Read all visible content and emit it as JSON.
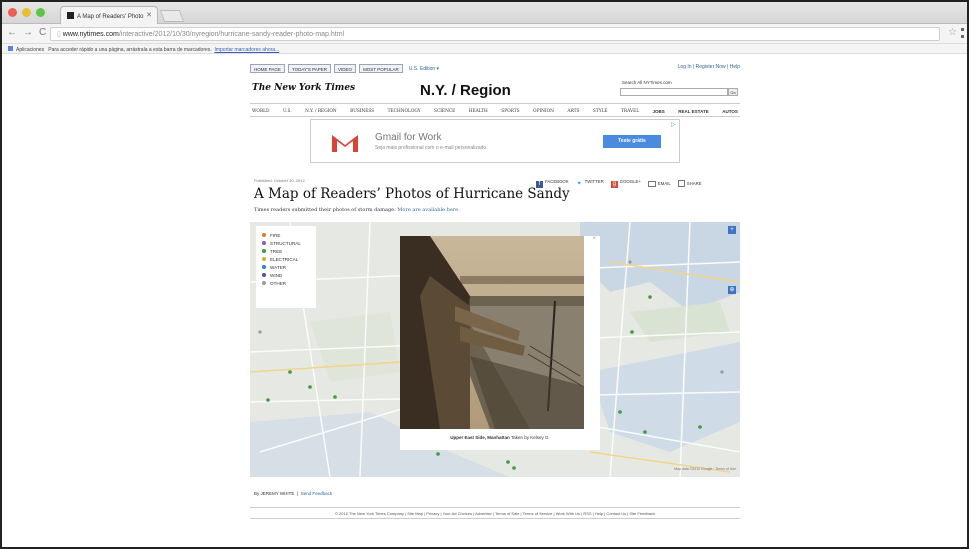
{
  "browser": {
    "tab_title": "A Map of Readers' Photo",
    "url_host": "www.nytimes.com",
    "url_path": "/interactive/2012/10/30/nyregion/hurricane-sandy-reader-photo-map.html",
    "bookmarks_apps": "Aplicaciones",
    "bookmarks_hint": "Para acceder rápido a una página, arrástrala a esta barra de marcadores.",
    "bookmarks_import": "Importar marcadores ahora..."
  },
  "topnav": {
    "items": [
      "HOME PAGE",
      "TODAY'S PAPER",
      "VIDEO",
      "MOST POPULAR"
    ],
    "edition": "U.S. Edition ▾",
    "login": "Log In",
    "register": "Register Now",
    "help": "Help"
  },
  "masthead": {
    "logo": "The New York Times",
    "section": "N.Y. / Region",
    "search_label": "Search All NYTimes.com",
    "search_go": "Go"
  },
  "sections": [
    "WORLD",
    "U.S.",
    "N.Y. / REGION",
    "BUSINESS",
    "TECHNOLOGY",
    "SCIENCE",
    "HEALTH",
    "SPORTS",
    "OPINION",
    "ARTS",
    "STYLE",
    "TRAVEL",
    "JOBS",
    "REAL ESTATE",
    "AUTOS"
  ],
  "ad": {
    "title": "Gmail for Work",
    "subtitle": "Seja mais profissional com o e-mail personalizado.",
    "button": "Teste grátis"
  },
  "article": {
    "published": "Published: October 30, 2012",
    "headline": "A Map of Readers’ Photos of Hurricane Sandy",
    "dek": "Times readers submitted their photos of storm damage.",
    "dek_link": "More are available here.",
    "byline": "By JEREMY WHITE",
    "feedback": "Send Feedback"
  },
  "share": {
    "facebook": "FACEBOOK",
    "twitter": "TWITTER",
    "google": "GOOGLE+",
    "email": "EMAIL",
    "share": "SHARE"
  },
  "legend": [
    {
      "label": "FIRE",
      "color": "#e07b2a"
    },
    {
      "label": "STRUCTURAL",
      "color": "#8a5bb5"
    },
    {
      "label": "TREE",
      "color": "#3d9b3a"
    },
    {
      "label": "ELECTRICAL",
      "color": "#d4b21c"
    },
    {
      "label": "WATER",
      "color": "#2f7fc1"
    },
    {
      "label": "WIND",
      "color": "#4b4f9c"
    },
    {
      "label": "OTHER",
      "color": "#9a9a9a"
    }
  ],
  "popup": {
    "location": "Upper East Side, Manhattan",
    "credit": "Taken by Kelsey G."
  },
  "map": {
    "credit": "Map data ©2012 Google · Terms of Use"
  },
  "footer": {
    "items": [
      "© 2012 The New York Times Company",
      "Site Map",
      "Privacy",
      "Your Ad Choices",
      "Advertise",
      "Terms of Sale",
      "Terms of Service",
      "Work With Us",
      "RSS",
      "Help",
      "Contact Us",
      "Site Feedback"
    ]
  }
}
